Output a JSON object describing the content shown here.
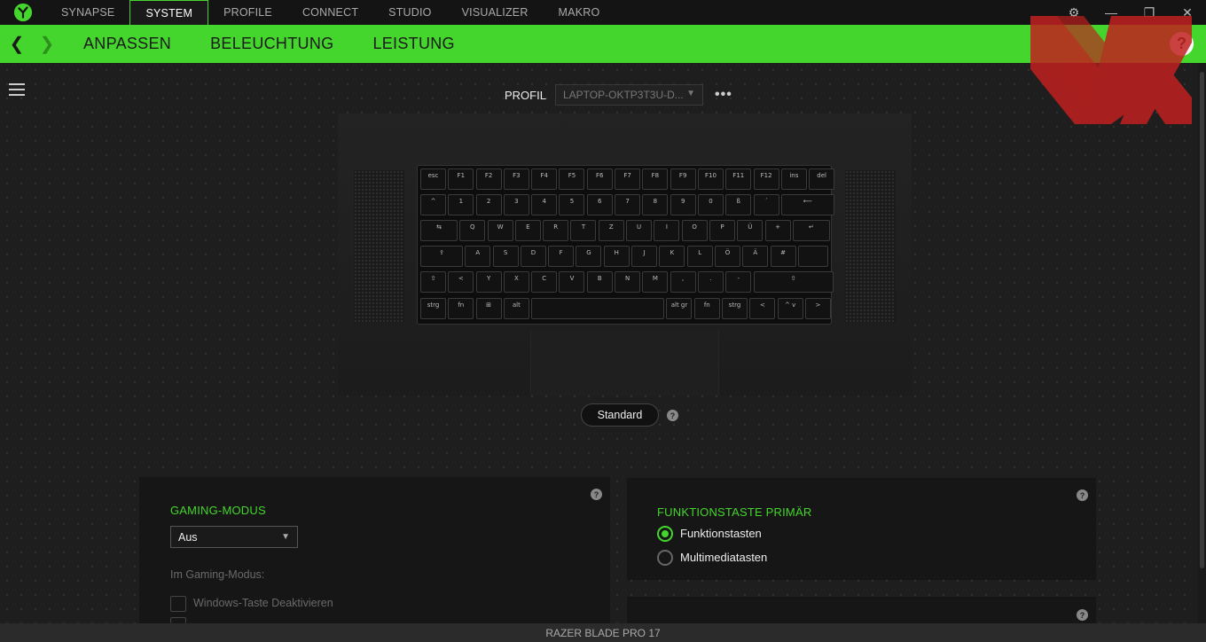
{
  "nav": {
    "tabs": [
      "SYNAPSE",
      "SYSTEM",
      "PROFILE",
      "CONNECT",
      "STUDIO",
      "VISUALIZER",
      "MAKRO"
    ],
    "active": "SYSTEM"
  },
  "subnav": {
    "tabs": [
      "ANPASSEN",
      "BELEUCHTUNG",
      "LEISTUNG"
    ],
    "active": "ANPASSEN"
  },
  "help_label": "?",
  "profile": {
    "label": "PROFIL",
    "value": "LAPTOP-OKTP3T3U-D...",
    "more": "•••"
  },
  "keyboard": {
    "rows": [
      [
        "esc",
        "F1",
        "F2",
        "F3",
        "F4",
        "F5",
        "F6",
        "F7",
        "F8",
        "F9",
        "F10",
        "F11",
        "F12",
        "ins",
        "del"
      ],
      [
        "^",
        "1",
        "2",
        "3",
        "4",
        "5",
        "6",
        "7",
        "8",
        "9",
        "0",
        "ß",
        "´",
        "⟵"
      ],
      [
        "⇆",
        "Q",
        "W",
        "E",
        "R",
        "T",
        "Z",
        "U",
        "I",
        "O",
        "P",
        "Ü",
        "+",
        "↵"
      ],
      [
        "⇪",
        "A",
        "S",
        "D",
        "F",
        "G",
        "H",
        "J",
        "K",
        "L",
        "Ö",
        "Ä",
        "#",
        ""
      ],
      [
        "⇧",
        "<",
        "Y",
        "X",
        "C",
        "V",
        "B",
        "N",
        "M",
        ",",
        ".",
        "-",
        "⇧"
      ],
      [
        "strg",
        "fn",
        "⊞",
        "alt",
        "",
        "alt gr",
        "fn",
        "strg",
        "<",
        "^ v",
        ">"
      ]
    ]
  },
  "standard_button": "Standard",
  "gaming_mode": {
    "title": "GAMING-MODUS",
    "dropdown_value": "Aus",
    "sub_label": "Im Gaming-Modus:",
    "option1": "Windows-Taste Deaktivieren"
  },
  "fn_primary": {
    "title": "FUNKTIONSTASTE PRIMÄR",
    "options": [
      "Funktionstasten",
      "Multimediatasten"
    ],
    "selected": "Funktionstasten"
  },
  "status": "RAZER BLADE PRO 17",
  "colors": {
    "accent": "#44d62c",
    "bg": "#1e1e1e",
    "watermark": "#c0201f"
  }
}
